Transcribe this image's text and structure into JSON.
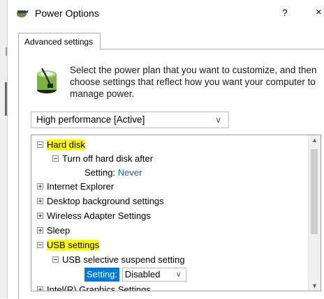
{
  "window": {
    "title": "Power Options",
    "help": "?",
    "close": "×"
  },
  "tabs": [
    {
      "label": "Advanced settings"
    }
  ],
  "description": "Select the power plan that you want to customize, and then choose settings that reflect how you want your computer to manage power.",
  "plan_select": {
    "value": "High performance [Active]"
  },
  "tree": [
    {
      "label": "Hard disk",
      "highlighted": true
    },
    {
      "label": "Turn off hard disk after"
    },
    {
      "label": "Setting:",
      "value": "Never"
    },
    {
      "label": "Internet Explorer"
    },
    {
      "label": "Desktop background settings"
    },
    {
      "label": "Wireless Adapter Settings"
    },
    {
      "label": "Sleep"
    },
    {
      "label": "USB settings",
      "highlighted": true
    },
    {
      "label": "USB selective suspend setting"
    },
    {
      "label": "Setting:",
      "value": "Disabled"
    },
    {
      "label": "Intel(R) Graphics Settings"
    }
  ]
}
